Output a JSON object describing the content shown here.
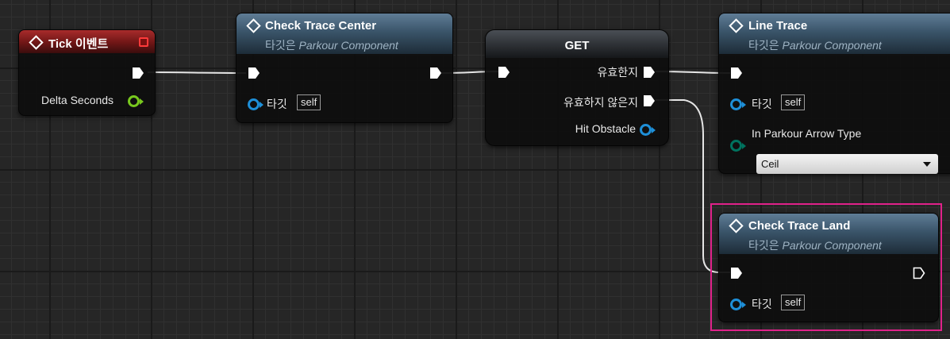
{
  "nodes": {
    "tick_event": {
      "title": "Tick 이벤트",
      "output_label": "Delta Seconds"
    },
    "check_trace_center": {
      "title": "Check Trace Center",
      "subtitle_prefix": "타깃은",
      "subtitle_target": "Parkour Component",
      "target_label": "타깃",
      "target_value": "self"
    },
    "get_node": {
      "title": "GET",
      "valid_label": "유효한지",
      "invalid_label": "유효하지 않은지",
      "output_label": "Hit Obstacle"
    },
    "line_trace": {
      "title": "Line Trace",
      "subtitle_prefix": "타깃은",
      "subtitle_target": "Parkour Component",
      "target_label": "타깃",
      "target_value": "self",
      "arrow_type_label": "In Parkour Arrow Type",
      "arrow_type_value": "Ceil"
    },
    "check_trace_land": {
      "title": "Check Trace Land",
      "subtitle_prefix": "타깃은",
      "subtitle_target": "Parkour Component",
      "target_label": "타깃",
      "target_value": "self"
    }
  },
  "colors": {
    "event_header": "#8b1e1e",
    "function_header": "#3a5469",
    "object_pin": "#1e8fd8",
    "float_pin": "#78c81e",
    "enum_pin": "#00725e",
    "highlight": "#e0218a"
  }
}
